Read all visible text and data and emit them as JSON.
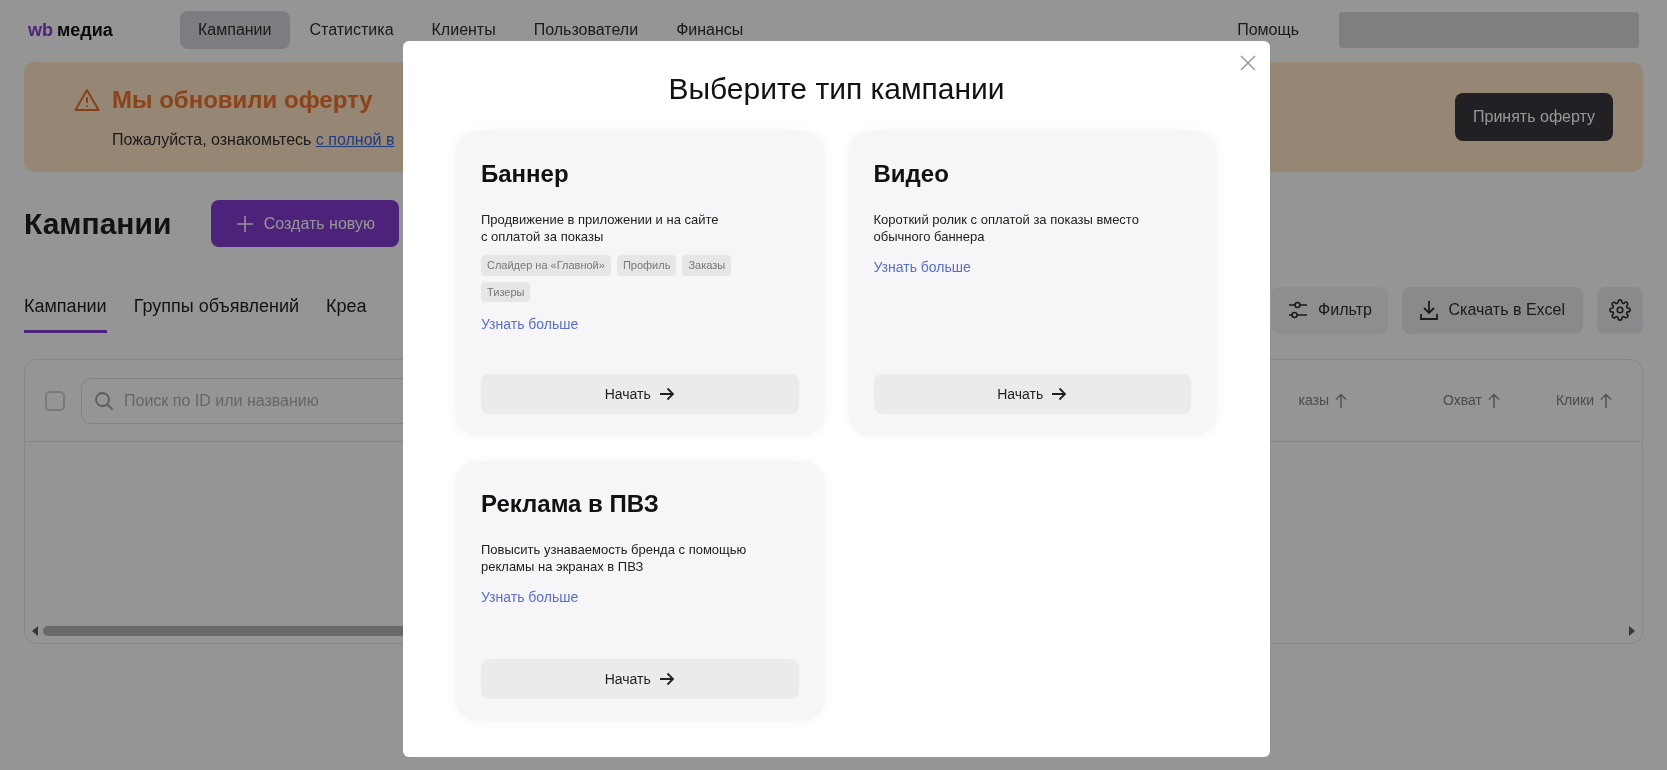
{
  "nav": {
    "logo_mark": "wb",
    "logo_text": "медиа",
    "items": [
      {
        "label": "Кампании",
        "selected": true
      },
      {
        "label": "Статистика",
        "selected": false
      },
      {
        "label": "Клиенты",
        "selected": false
      },
      {
        "label": "Пользователи",
        "selected": false
      },
      {
        "label": "Финансы",
        "selected": false
      }
    ],
    "help": "Помощь"
  },
  "notice": {
    "title": "Мы обновили оферту",
    "text": "Пожалуйста, ознакомьтесь ",
    "link": "с полной в",
    "button": "Принять оферту"
  },
  "page": {
    "title": "Кампании",
    "create_button": "Создать новую"
  },
  "tabs": [
    {
      "label": "Кампании",
      "selected": true
    },
    {
      "label": "Группы объявлений",
      "selected": false
    },
    {
      "label": "Креа",
      "selected": false
    }
  ],
  "toolbar": {
    "filter": "Фильтр",
    "download": "Скачать в Excel"
  },
  "table": {
    "select_all": {
      "checked": false
    },
    "search": {
      "placeholder": "Поиск по ID или названию"
    },
    "columns": [
      "казы",
      "Охват",
      "Клики"
    ]
  },
  "modal": {
    "title": "Выберите тип кампании",
    "cards": [
      {
        "title": "Баннер",
        "description": "Продвижение в приложении и на сайте\nс оплатой за показы",
        "tags": [
          "Слайдер на «Главной»",
          "Профиль",
          "Заказы",
          "Тизеры"
        ],
        "link": "Узнать больше",
        "button": "Начать"
      },
      {
        "title": "Видео",
        "description": "Короткий ролик с оплатой за показы вместо\nобычного баннера",
        "link": "Узнать больше",
        "button": "Начать"
      },
      {
        "title": "Реклама в ПВЗ",
        "description": "Повысить узнаваемость бренда с помощью\nрекламы на экранах в ПВЗ",
        "link": "Узнать больше",
        "button": "Начать"
      }
    ]
  }
}
